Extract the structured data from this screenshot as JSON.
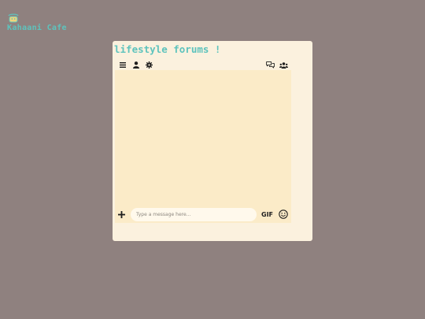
{
  "brand": {
    "logo_icon": "coffee-cup-icon",
    "name": "Kahaani Cafe",
    "accent_color": "#5ec3bd"
  },
  "forum": {
    "title": "lifestyle forums !",
    "toolbar_left_icons": [
      "menu-icon",
      "user-icon",
      "gear-icon"
    ],
    "toolbar_right_icons": [
      "chat-bubbles-icon",
      "users-group-icon"
    ]
  },
  "composer": {
    "add_icon": "plus-icon",
    "placeholder": "Type a message here...",
    "gif_label": "GIF",
    "emoji_icon": "smiley-icon"
  },
  "colors": {
    "background": "#8f817f",
    "panel": "#fbf1de",
    "chat_area": "#fbebc8",
    "input": "#fff9ec"
  }
}
